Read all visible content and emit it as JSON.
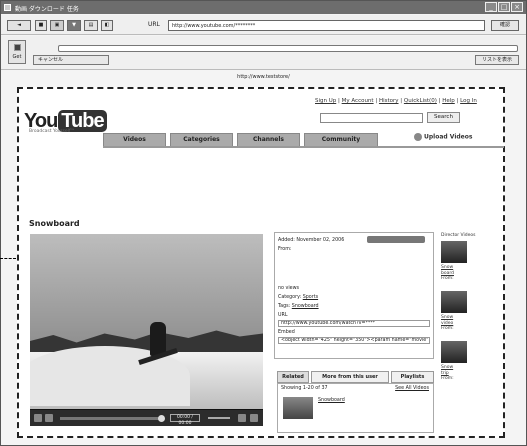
{
  "window": {
    "title": "動画 ダウンロード 任务",
    "url_label": "URL",
    "url_value": "http://www.youtube.com/********",
    "go_label": "確認",
    "cancel_label": "キャンセル",
    "get_label": "Get",
    "hide_label": "リストを表示",
    "status_url": "http://www.teststore/"
  },
  "youtube": {
    "logo_you": "You",
    "logo_tube": "Tube",
    "slogan": "Broadcast Yourself™",
    "top_links": [
      "Sign Up",
      "My Account",
      "History",
      "QuickList(0)",
      "Help",
      "Log In"
    ],
    "search_label": "Search",
    "nav_tabs": [
      "Videos",
      "Categories",
      "Channels",
      "Community"
    ],
    "upload_label": "Upload Videos",
    "video_title": "Snowboard",
    "time_display": "00:00 / 00:00",
    "info": {
      "added": "Added: November 02, 2006",
      "from": "From:",
      "category_label": "Category:",
      "category_value": "Sports",
      "tags_label": "Tags:",
      "tags_value": "Snowboard",
      "url_label": "URL",
      "url_value": "http://www.youtube.com/watch?v=****",
      "embed_label": "Embed",
      "embed_value": "<object width=\"425\" height=\"350\"><param name=\"movie\"",
      "views": "no views"
    },
    "related_tabs": [
      "Related",
      "More from this user",
      "Playlists"
    ],
    "related_showing": "Showing 1-20 of 37",
    "related_see_all": "See All Videos",
    "related_video_title": "Snowboard",
    "sidebar_title": "Director Videos",
    "sidebar_items": [
      {
        "line1": "Snow",
        "line2": "board",
        "line3": "From:"
      },
      {
        "line1": "Snow",
        "line2": "video",
        "line3": "From:"
      },
      {
        "line1": "Snow",
        "line2": "trip",
        "line3": "From:"
      }
    ]
  }
}
